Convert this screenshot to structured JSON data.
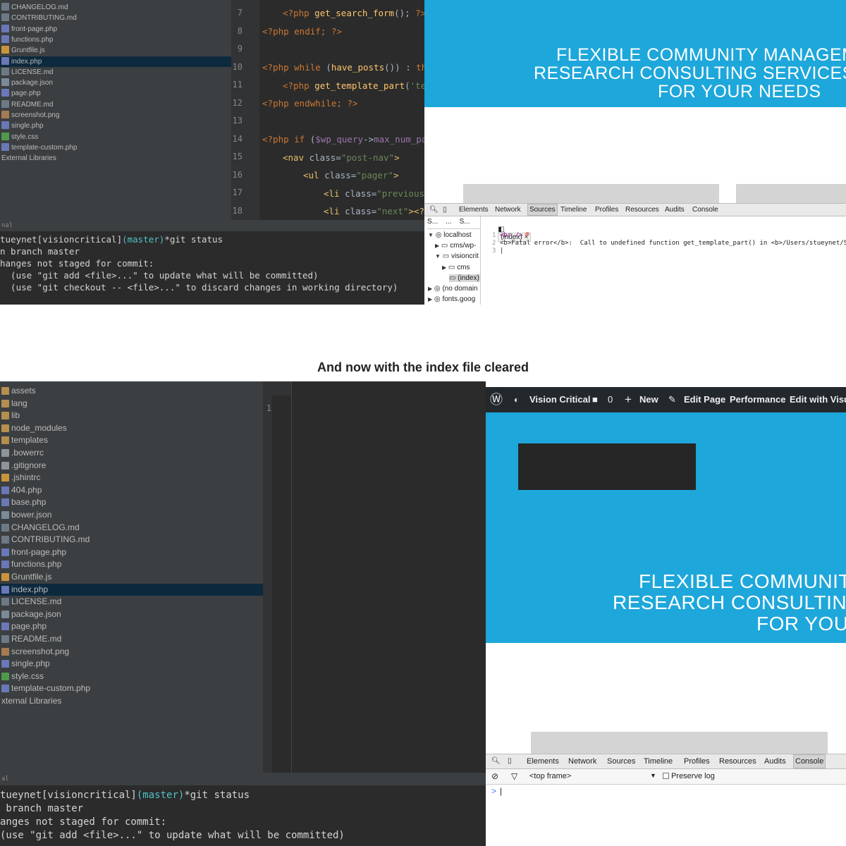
{
  "top": {
    "project_tree": [
      {
        "label": "CHANGELOG.md",
        "type": "md"
      },
      {
        "label": "CONTRIBUTING.md",
        "type": "md"
      },
      {
        "label": "front-page.php",
        "type": "php"
      },
      {
        "label": "functions.php",
        "type": "php"
      },
      {
        "label": "Gruntfile.js",
        "type": "js"
      },
      {
        "label": "index.php",
        "type": "php",
        "selected": true
      },
      {
        "label": "LICENSE.md",
        "type": "md"
      },
      {
        "label": "package.json",
        "type": "json"
      },
      {
        "label": "page.php",
        "type": "php"
      },
      {
        "label": "README.md",
        "type": "md"
      },
      {
        "label": "screenshot.png",
        "type": "png"
      },
      {
        "label": "single.php",
        "type": "php"
      },
      {
        "label": "style.css",
        "type": "css"
      },
      {
        "label": "template-custom.php",
        "type": "php"
      },
      {
        "label": "External Libraries",
        "type": "none"
      }
    ],
    "line_numbers": [
      "7",
      "8",
      "9",
      "10",
      "11",
      "12",
      "13",
      "14",
      "15",
      "16",
      "17",
      "18"
    ],
    "terminal_header": "nal",
    "terminal": {
      "user": "tueynet[visioncritical]",
      "branch": "(master)",
      "command": "*git status",
      "lines": [
        "n branch master",
        "hanges not staged for commit:",
        "  (use \"git add <file>...\" to update what will be committed)",
        "  (use \"git checkout -- <file>...\" to discard changes in working directory)"
      ]
    },
    "hero_lines": [
      "FLEXIBLE COMMUNITY MANAGEMEN",
      "RESEARCH CONSULTING SERVICES CUS",
      "FOR YOUR NEEDS"
    ],
    "devtools_tabs": [
      "Elements",
      "Network",
      "Sources",
      "Timeline",
      "Profiles",
      "Resources",
      "Audits",
      "Console"
    ],
    "devtools_active": "Sources",
    "sources_subtabs": [
      "S...",
      "...",
      "S..."
    ],
    "source_file_tab": "(index)",
    "source_tree": [
      {
        "label": "localhost",
        "indent": 0,
        "arrow": "▼"
      },
      {
        "label": "cms/wp-",
        "indent": 1,
        "arrow": "▶"
      },
      {
        "label": "visioncrit",
        "indent": 1,
        "arrow": "▼"
      },
      {
        "label": "cms",
        "indent": 2,
        "arrow": "▶"
      },
      {
        "label": "(index)",
        "indent": 3,
        "arrow": "",
        "selected": true
      },
      {
        "label": "(no domain",
        "indent": 0,
        "arrow": "▶"
      },
      {
        "label": "fonts.goog",
        "indent": 0,
        "arrow": "▶"
      }
    ],
    "source_code": [
      {
        "n": "1",
        "text": "<br />"
      },
      {
        "n": "2",
        "text": "<b>Fatal error</b>:  Call to undefined function get_template_part() in <b>/Users/stueynet/Sit"
      },
      {
        "n": "3",
        "text": ""
      }
    ]
  },
  "caption": "And now with the index file cleared",
  "bottom": {
    "project_tree": [
      {
        "label": "assets",
        "type": "folder"
      },
      {
        "label": "lang",
        "type": "folder"
      },
      {
        "label": "lib",
        "type": "folder"
      },
      {
        "label": "node_modules",
        "type": "folder"
      },
      {
        "label": "templates",
        "type": "folder"
      },
      {
        "label": ".bowerrc",
        "type": "blank"
      },
      {
        "label": ".gitignore",
        "type": "blank"
      },
      {
        "label": ".jshintrc",
        "type": "js"
      },
      {
        "label": "404.php",
        "type": "php"
      },
      {
        "label": "base.php",
        "type": "php"
      },
      {
        "label": "bower.json",
        "type": "json"
      },
      {
        "label": "CHANGELOG.md",
        "type": "md"
      },
      {
        "label": "CONTRIBUTING.md",
        "type": "md"
      },
      {
        "label": "front-page.php",
        "type": "php"
      },
      {
        "label": "functions.php",
        "type": "php"
      },
      {
        "label": "Gruntfile.js",
        "type": "js"
      },
      {
        "label": "index.php",
        "type": "php",
        "selected": true
      },
      {
        "label": "LICENSE.md",
        "type": "md"
      },
      {
        "label": "package.json",
        "type": "json"
      },
      {
        "label": "page.php",
        "type": "php"
      },
      {
        "label": "README.md",
        "type": "md"
      },
      {
        "label": "screenshot.png",
        "type": "png"
      },
      {
        "label": "single.php",
        "type": "php"
      },
      {
        "label": "style.css",
        "type": "css"
      },
      {
        "label": "template-custom.php",
        "type": "php"
      },
      {
        "label": "xternal Libraries",
        "type": "none"
      }
    ],
    "line_number": "1",
    "terminal_header": "al",
    "terminal": {
      "user": "tueynet[visioncritical]",
      "branch": "(master)",
      "command": "*git status",
      "lines": [
        " branch master",
        "anges not staged for commit:",
        "(use \"git add <file>...\" to update what will be committed)"
      ]
    },
    "admin_bar": {
      "site": "Vision Critical",
      "comments": "0",
      "new": "New",
      "edit_page": "Edit Page",
      "performance": "Performance",
      "edit_with": "Edit with Visua"
    },
    "hero_lines": [
      "FLEXIBLE COMMUNITY",
      "RESEARCH CONSULTING S",
      "FOR YOUR"
    ],
    "devtools_tabs": [
      "Elements",
      "Network",
      "Sources",
      "Timeline",
      "Profiles",
      "Resources",
      "Audits",
      "Console"
    ],
    "devtools_active": "Console",
    "frame_select": "<top frame>",
    "preserve_log": "Preserve log",
    "prompt": ">"
  }
}
